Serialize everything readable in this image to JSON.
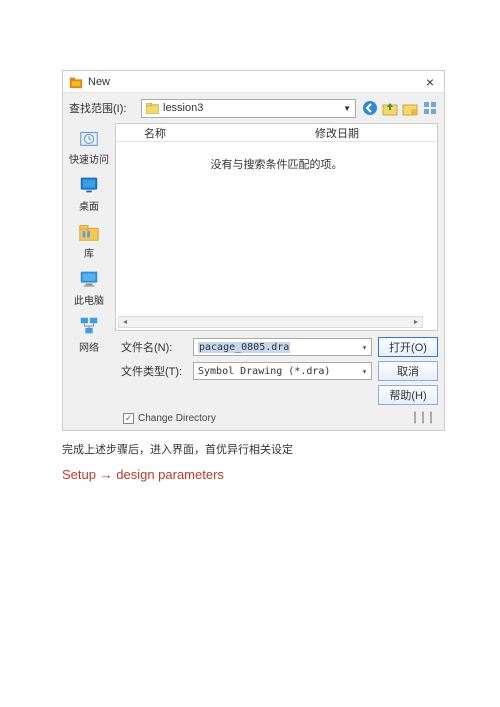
{
  "titlebar": {
    "title": "New",
    "close": "×"
  },
  "subbar": {
    "label": "查找范围(I):",
    "path": "lession3"
  },
  "sidebar": {
    "items": [
      {
        "label": "快速访问"
      },
      {
        "label": "桌面"
      },
      {
        "label": "库"
      },
      {
        "label": "此电脑"
      },
      {
        "label": "网络"
      }
    ]
  },
  "list": {
    "col_blank": "",
    "col_name": "名称",
    "col_date": "修改日期",
    "empty": "没有与搜索条件匹配的项。"
  },
  "filename": {
    "label": "文件名(N):",
    "value": "pacage_0805.dra"
  },
  "filetype": {
    "label": "文件类型(T):",
    "value": "Symbol Drawing (*.dra)"
  },
  "buttons": {
    "open": "打开(O)",
    "cancel": "取消",
    "help": "帮助(H)"
  },
  "footer": {
    "checkbox": "Change Directory"
  },
  "hint_below": "完成上述步骤后，进入界面，首优异行相关设定",
  "hint_nav": {
    "a": "Setup",
    "arrow": "→",
    "b": "design parameters"
  }
}
